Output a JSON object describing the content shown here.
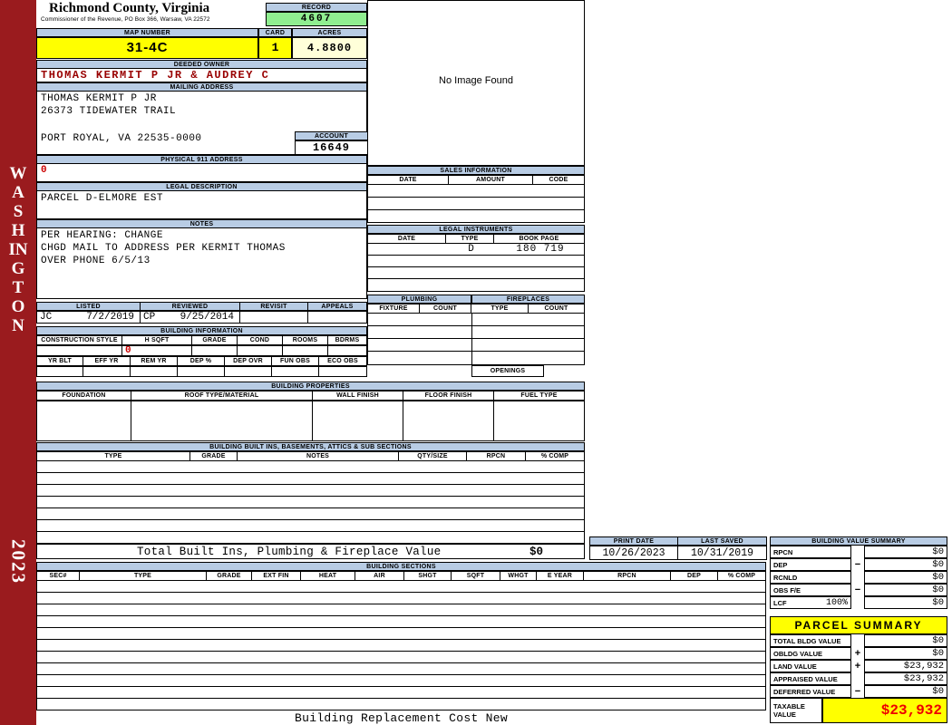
{
  "colors": {
    "header_blue": "#b8cce4",
    "highlight_yellow": "#ffff00",
    "record_green": "#90ee90",
    "acres_cream": "#ffffd9",
    "sidebar_red": "#9a1b1e",
    "owner_red": "#990000",
    "alert_red": "#cc0000",
    "taxable_red": "#ee0000"
  },
  "sidebar": {
    "state": "WASHINGTON",
    "year": "2023"
  },
  "header": {
    "county": "Richmond County, Virginia",
    "subtitle": "Commissioner of the Revenue, PO Box 366, Warsaw, VA 22572",
    "record_label": "RECORD",
    "record_value": "4607",
    "map_number_label": "MAP NUMBER",
    "map_number_value": "31-4C",
    "card_label": "CARD",
    "card_value": "1",
    "acres_label": "ACRES",
    "acres_value": "4.8800"
  },
  "owner": {
    "deeded_owner_label": "DEEDED OWNER",
    "deeded_owner": "THOMAS KERMIT P JR & AUDREY C",
    "mailing_label": "MAILING ADDRESS",
    "mailing_line1": "THOMAS KERMIT P JR",
    "mailing_line2": "26373 TIDEWATER TRAIL",
    "mailing_line3": "PORT ROYAL, VA 22535-0000",
    "account_label": "ACCOUNT",
    "account_value": "16649",
    "physical_label": "PHYSICAL 911 ADDRESS",
    "physical_value": "0",
    "legal_label": "LEGAL DESCRIPTION",
    "legal_value": "PARCEL D-ELMORE EST",
    "notes_label": "NOTES",
    "notes_line1": "PER HEARING: CHANGE",
    "notes_line2": "CHGD MAIL TO ADDRESS PER KERMIT THOMAS",
    "notes_line3": "OVER PHONE 6/5/13"
  },
  "image_box": {
    "message": "No Image Found"
  },
  "sales": {
    "title": "SALES INFORMATION",
    "columns": [
      "DATE",
      "AMOUNT",
      "CODE"
    ]
  },
  "legal_instruments": {
    "title": "LEGAL INSTRUMENTS",
    "columns": [
      "DATE",
      "TYPE",
      "BOOK PAGE"
    ],
    "row1": {
      "date": "",
      "type": "D",
      "book_page": "180 719"
    }
  },
  "plumbing": {
    "title": "PLUMBING",
    "columns": [
      "FIXTURE",
      "COUNT"
    ]
  },
  "fireplaces": {
    "title": "FIREPLACES",
    "columns": [
      "TYPE",
      "COUNT"
    ],
    "openings_label": "OPENINGS"
  },
  "review": {
    "labels": [
      "LISTED",
      "REVIEWED",
      "REVISIT",
      "APPEALS"
    ],
    "listed_by": "JC",
    "listed_date": "7/2/2019",
    "reviewed_by": "CP",
    "reviewed_date": "9/25/2014"
  },
  "building_information": {
    "title": "BUILDING INFORMATION",
    "columns_top": [
      "CONSTRUCTION STYLE",
      "H SQFT",
      "GRADE",
      "COND",
      "ROOMS",
      "BDRMS"
    ],
    "h_sqft_value": "0",
    "columns_bottom": [
      "YR BLT",
      "EFF YR",
      "REM YR",
      "DEP %",
      "DEP OVR",
      "FUN OBS",
      "ECO OBS"
    ]
  },
  "building_properties": {
    "title": "BUILDING PROPERTIES",
    "columns": [
      "FOUNDATION",
      "ROOF TYPE/MATERIAL",
      "WALL FINISH",
      "FLOOR FINISH",
      "FUEL TYPE"
    ]
  },
  "built_ins": {
    "title": "BUILDING BUILT INS, BASEMENTS, ATTICS & SUB SECTIONS",
    "columns": [
      "TYPE",
      "GRADE",
      "NOTES",
      "QTY/SIZE",
      "RPCN",
      "% COMP"
    ],
    "total_label": "Total Built Ins, Plumbing & Fireplace Value",
    "total_value": "$0"
  },
  "print_info": {
    "print_date_label": "PRINT DATE",
    "print_date": "10/26/2023",
    "last_saved_label": "LAST SAVED",
    "last_saved": "10/31/2019"
  },
  "building_value_summary": {
    "title": "BUILDING VALUE SUMMARY",
    "rows": [
      {
        "label": "RPCN",
        "op": "",
        "value": "$0"
      },
      {
        "label": "DEP",
        "op": "−",
        "value": "$0"
      },
      {
        "label": "RCNLD",
        "op": "",
        "value": "$0"
      },
      {
        "label": "OBS F/E",
        "op": "−",
        "value": "$0"
      },
      {
        "label": "LCF",
        "pct": "100%",
        "op": "",
        "value": "$0"
      }
    ]
  },
  "building_sections": {
    "title": "BUILDING SECTIONS",
    "columns": [
      "SEC#",
      "TYPE",
      "GRADE",
      "EXT FIN",
      "HEAT",
      "AIR",
      "SHGT",
      "SQFT",
      "WHGT",
      "E YEAR",
      "RPCN",
      "DEP",
      "% COMP"
    ]
  },
  "parcel_summary": {
    "title": "PARCEL SUMMARY",
    "rows": [
      {
        "label": "TOTAL BLDG VALUE",
        "op": "",
        "value": "$0"
      },
      {
        "label": "OBLDG VALUE",
        "op": "+",
        "value": "$0"
      },
      {
        "label": "LAND VALUE",
        "op": "+",
        "value": "$23,932"
      },
      {
        "label": "APPRAISED VALUE",
        "op": "",
        "value": "$23,932"
      },
      {
        "label": "DEFERRED VALUE",
        "op": "−",
        "value": "$0"
      }
    ],
    "taxable_label": "TAXABLE VALUE",
    "taxable_value": "$23,932"
  },
  "footer": {
    "text": "Building Replacement Cost New"
  }
}
